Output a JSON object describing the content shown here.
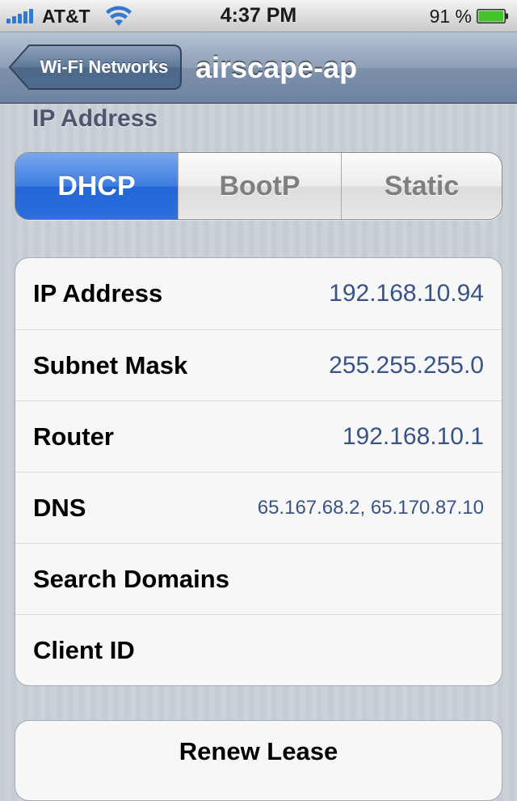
{
  "status_bar": {
    "carrier": "AT&T",
    "time": "4:37 PM",
    "battery_percent": "91 %",
    "signal_icon": "signal-bars-icon",
    "wifi_icon": "wifi-icon",
    "battery_icon": "battery-icon"
  },
  "nav": {
    "back_label": "Wi-Fi Networks",
    "title": "airscape-ap"
  },
  "ip_section": {
    "header": "IP Address",
    "segments": [
      {
        "label": "DHCP",
        "selected": true
      },
      {
        "label": "BootP",
        "selected": false
      },
      {
        "label": "Static",
        "selected": false
      }
    ]
  },
  "details": {
    "rows": [
      {
        "label": "IP Address",
        "value": "192.168.10.94"
      },
      {
        "label": "Subnet Mask",
        "value": "255.255.255.0"
      },
      {
        "label": "Router",
        "value": "192.168.10.1"
      },
      {
        "label": "DNS",
        "value": "65.167.68.2, 65.170.87.10"
      },
      {
        "label": "Search Domains",
        "value": ""
      },
      {
        "label": "Client ID",
        "value": ""
      }
    ]
  },
  "renew": {
    "label": "Renew Lease"
  },
  "colors": {
    "accent_blue": "#2c6fdd",
    "value_text": "#385487",
    "battery_green": "#43c22a"
  }
}
